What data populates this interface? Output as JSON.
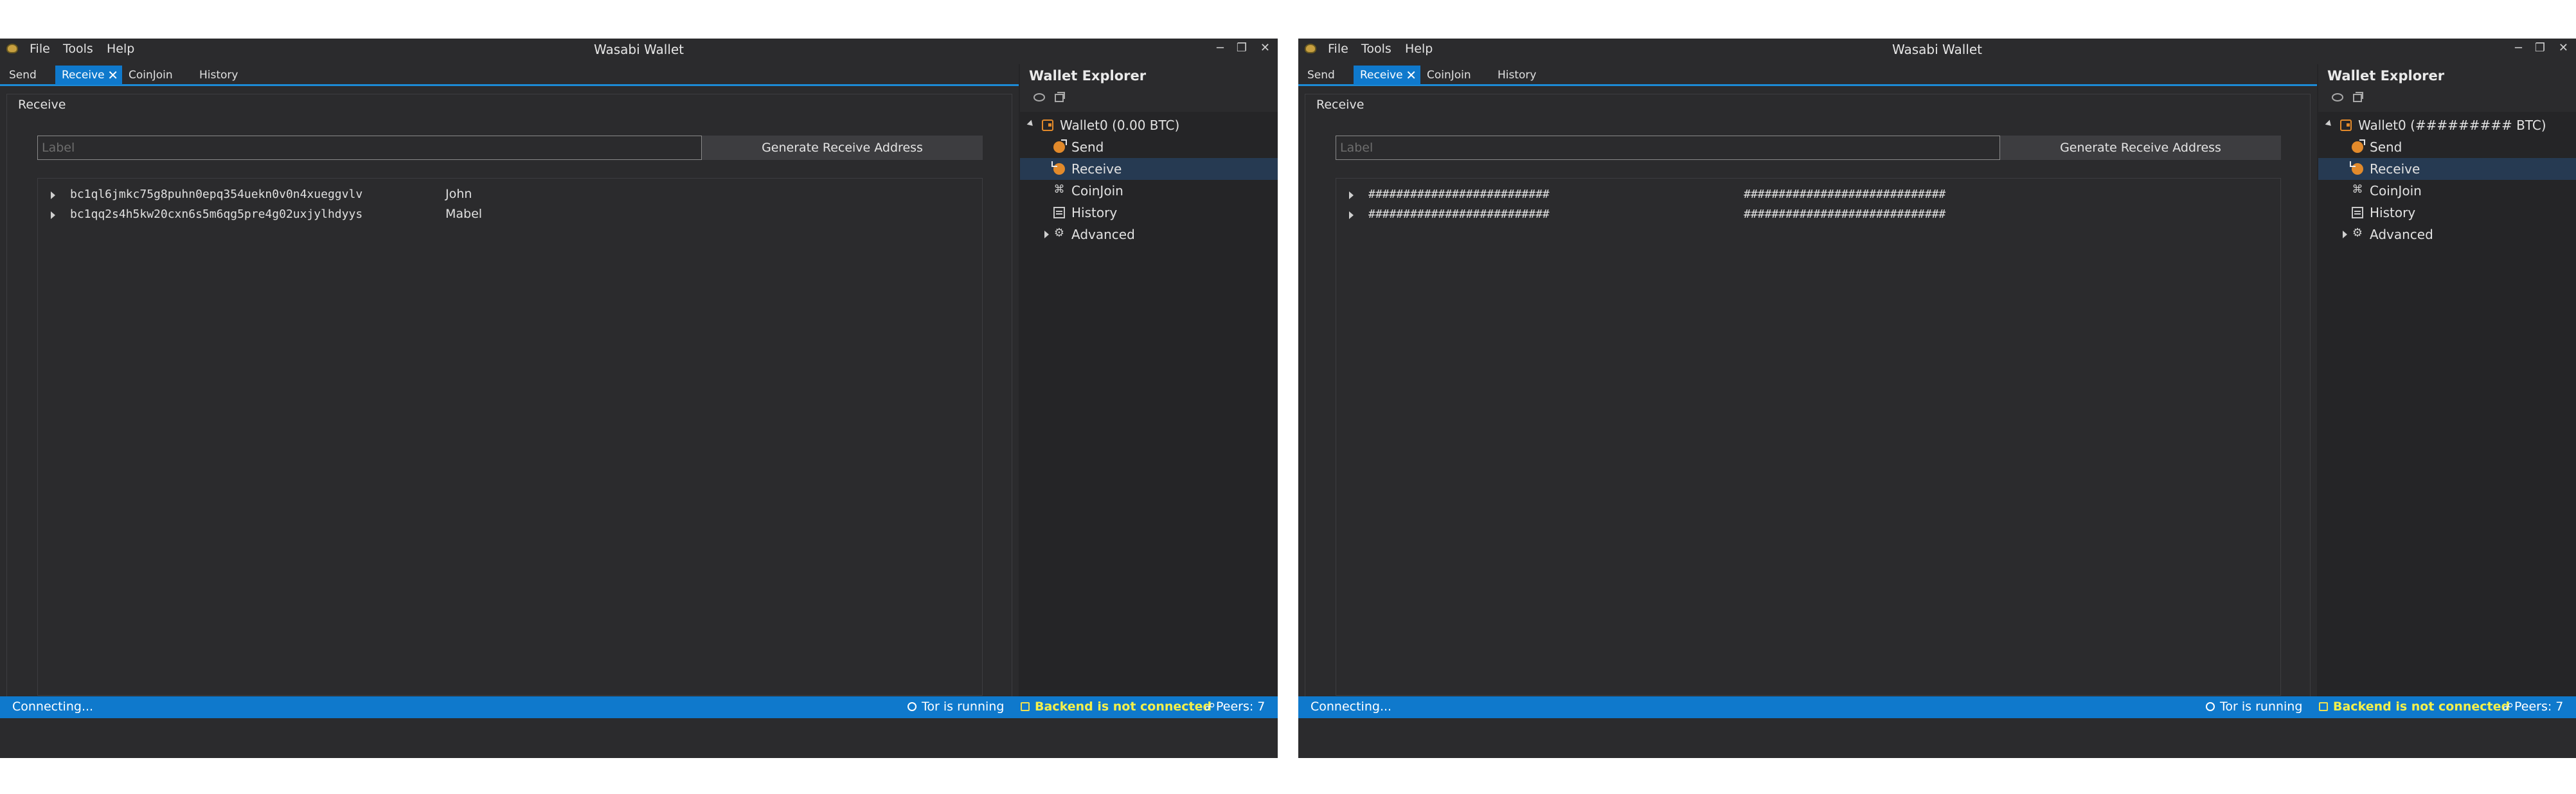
{
  "windows": [
    {
      "menu": [
        "File",
        "Tools",
        "Help"
      ],
      "title": "Wasabi Wallet",
      "tabs": [
        "Send",
        "Receive",
        "CoinJoin",
        "History"
      ],
      "panel_title": "Receive",
      "label_placeholder": "Label",
      "generate_button": "Generate Receive Address",
      "addresses": [
        {
          "address": "bc1ql6jmkc75g8puhn0epq354uekn0v0n4xueggvlv",
          "label": "John"
        },
        {
          "address": "bc1qq2s4h5kw20cxn6s5m6qg5pre4g02uxjylhdyys",
          "label": "Mabel"
        }
      ],
      "explorer": {
        "title": "Wallet Explorer",
        "wallet": "Wallet0 (0.00 BTC)",
        "items": [
          "Send",
          "Receive",
          "CoinJoin",
          "History",
          "Advanced"
        ]
      },
      "status": {
        "connecting": "Connecting...",
        "tor": "Tor is running",
        "backend": "Backend is not connected",
        "peers": "Peers: 7"
      }
    },
    {
      "menu": [
        "File",
        "Tools",
        "Help"
      ],
      "title": "Wasabi Wallet",
      "tabs": [
        "Send",
        "Receive",
        "CoinJoin",
        "History"
      ],
      "panel_title": "Receive",
      "label_placeholder": "Label",
      "generate_button": "Generate Receive Address",
      "addresses": [
        {
          "address": "##########################",
          "label": "#############################"
        },
        {
          "address": "##########################",
          "label": "#############################"
        }
      ],
      "explorer": {
        "title": "Wallet Explorer",
        "wallet": "Wallet0 (######### BTC)",
        "items": [
          "Send",
          "Receive",
          "CoinJoin",
          "History",
          "Advanced"
        ]
      },
      "status": {
        "connecting": "Connecting...",
        "tor": "Tor is running",
        "backend": "Backend is not connected",
        "peers": "Peers: 7"
      }
    }
  ],
  "colors": {
    "window_bg": "#2b2b2d",
    "accent": "#0f79cc",
    "selected_row": "#263a52",
    "backend_warning": "#f4f04a",
    "wallet_orange": "#e28a2b"
  }
}
